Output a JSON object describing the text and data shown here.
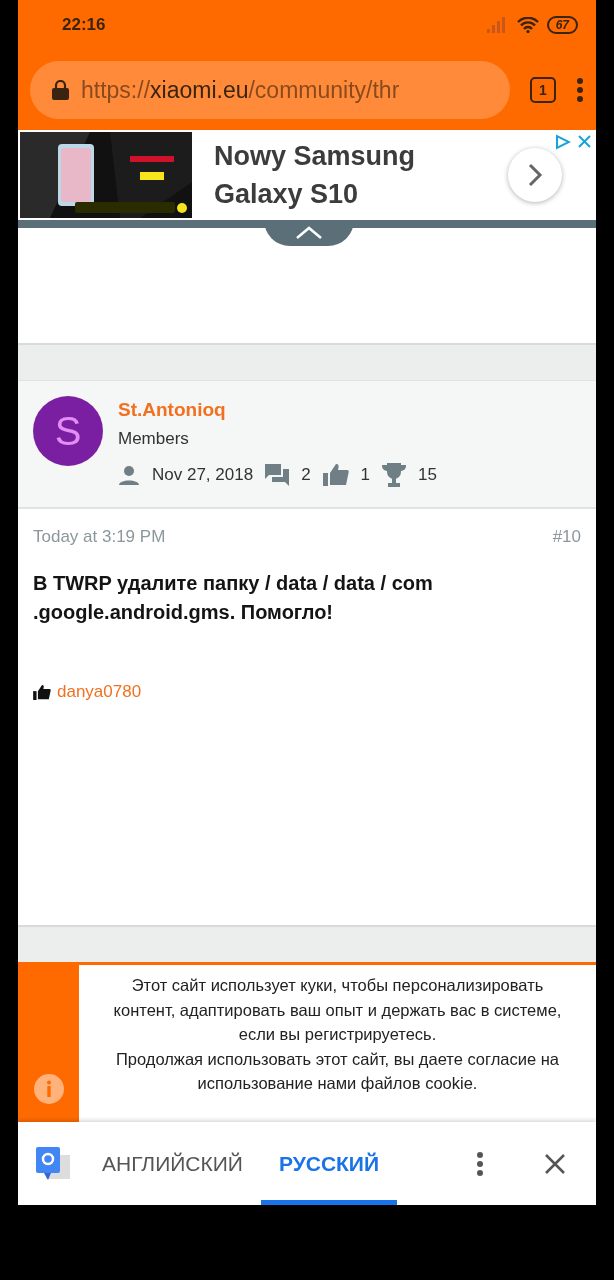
{
  "status_bar": {
    "time": "22:16",
    "battery": "67"
  },
  "address_bar": {
    "scheme": "https://",
    "host": "xiaomi.eu",
    "path": "/community/thr",
    "tab_count": "1"
  },
  "ad": {
    "headline": "Nowy Samsung Galaxy S10"
  },
  "post": {
    "author": {
      "initial": "S",
      "name": "St.Antonioq",
      "role": "Members",
      "joined": "Nov 27, 2018",
      "messages": "2",
      "likes": "1",
      "points": "15"
    },
    "time": "Today at 3:19 PM",
    "number": "#10",
    "body": "В TWRP удалите папку / data / data / com .google.android.gms. Помогло!",
    "liked_by": "danya0780"
  },
  "cookie_notice": {
    "lines": [
      "Этот сайт использует куки, чтобы персонализировать контент, адаптировать ваш опыт и держать вас в системе, если вы регистрируетесь.",
      "Продолжая использовать этот сайт, вы даете согласие на использование нами файлов cookie."
    ]
  },
  "translate_bar": {
    "tabs": [
      {
        "label": "АНГЛИЙСКИЙ",
        "selected": false
      },
      {
        "label": "РУССКИЙ",
        "selected": true
      }
    ]
  }
}
